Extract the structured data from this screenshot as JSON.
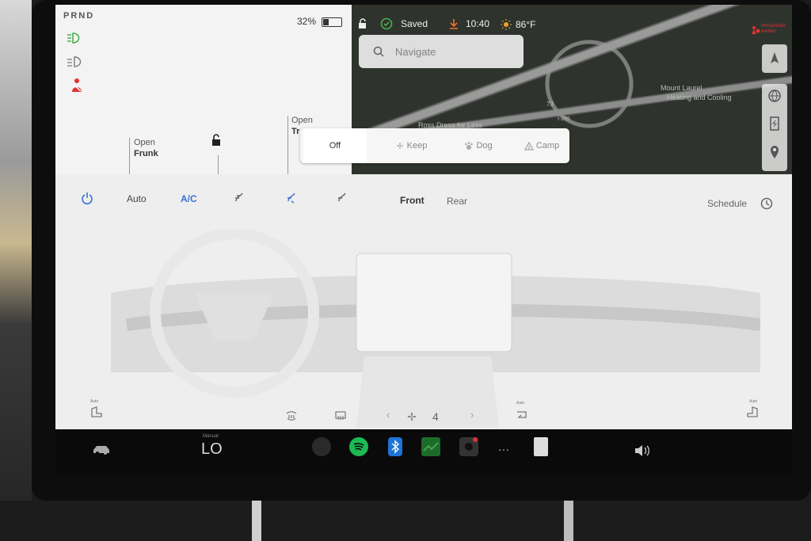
{
  "vehicle": {
    "gear": "PRND",
    "battery_percent": "32%",
    "battery_level": 0.32,
    "frunk_open_label": "Open",
    "frunk_label": "Frunk",
    "trunk_open_label": "Open",
    "trunk_label": "Tr"
  },
  "status": {
    "saved_label": "Saved",
    "time": "10:40",
    "temperature": "86°F",
    "airbag_label_1": "PASSENGER",
    "airbag_label_2": "AIRBAG"
  },
  "map": {
    "search_placeholder": "Navigate",
    "poi_1": "Mount Laurel",
    "poi_1b": "Heating and Cooling",
    "poi_2": "Ross Dress for Less",
    "route_shield_1": "73",
    "route_shield_2": "I-295"
  },
  "camp_mode": {
    "options": [
      "Off",
      "Keep",
      "Dog",
      "Camp"
    ],
    "selected": "Off"
  },
  "climate": {
    "auto_label": "Auto",
    "ac_label": "A/C",
    "front_label": "Front",
    "rear_label": "Rear",
    "schedule_label": "Schedule",
    "fan_speed": "4",
    "seat_auto_label": "Auto"
  },
  "dock": {
    "temp_mode_label": "Manual",
    "temp_value": "LO"
  },
  "colors": {
    "accent_blue": "#3b6fd8",
    "light_green": "#4caf50",
    "seatbelt_red": "#d33333"
  }
}
